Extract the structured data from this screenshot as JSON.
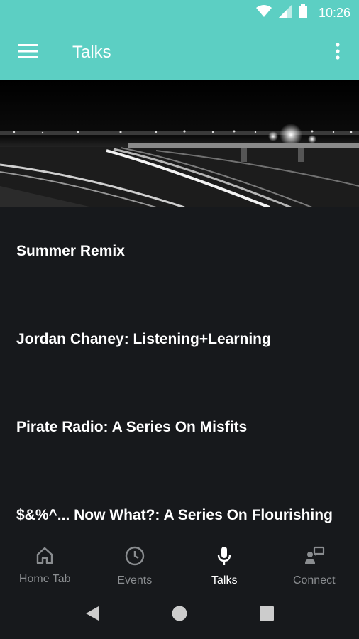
{
  "status_bar": {
    "time": "10:26",
    "icons": [
      "wifi-icon",
      "cell-signal-icon",
      "battery-icon"
    ]
  },
  "app_bar": {
    "title": "Talks",
    "left_icon": "menu-icon",
    "right_icon": "more-vert-icon",
    "color": "#5ccfc3"
  },
  "hero": {
    "description_icon": "night-highway-banner"
  },
  "talks": [
    {
      "title": "Summer Remix"
    },
    {
      "title": "Jordan Chaney: Listening+Learning"
    },
    {
      "title": "Pirate Radio: A Series On Misfits"
    },
    {
      "title": "$&%^... Now What?: A Series On Flourishing"
    }
  ],
  "bottom_nav": [
    {
      "label": "Home Tab",
      "icon": "home-icon",
      "active": false
    },
    {
      "label": "Events",
      "icon": "clock-icon",
      "active": false
    },
    {
      "label": "Talks",
      "icon": "microphone-icon",
      "active": true
    },
    {
      "label": "Connect",
      "icon": "connect-icon",
      "active": false
    }
  ],
  "system_nav": [
    "back-icon",
    "home-circle-icon",
    "recents-icon"
  ],
  "colors": {
    "background": "#17191c",
    "accent": "#5ccfc3",
    "inactive": "#8a8d90"
  }
}
